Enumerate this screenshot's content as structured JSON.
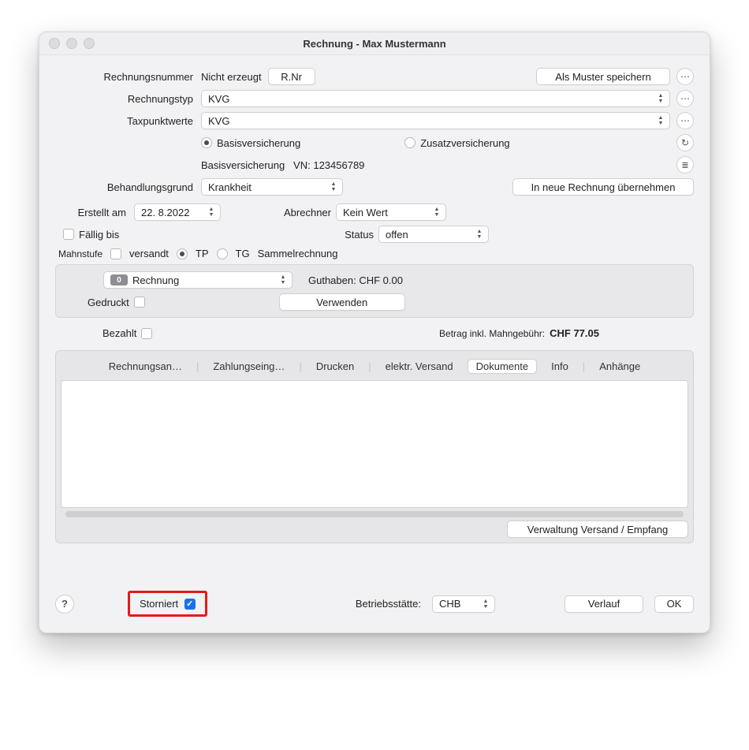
{
  "window": {
    "title": "Rechnung - Max Mustermann"
  },
  "labels": {
    "rechnungsnummer": "Rechnungsnummer",
    "rechnungstyp": "Rechnungstyp",
    "taxpunktwerte": "Taxpunktwerte",
    "behandlungsgrund": "Behandlungsgrund",
    "erstellt_am": "Erstellt am",
    "abrechner": "Abrechner",
    "faellig_bis": "Fällig bis",
    "status": "Status",
    "mahnstufe": "Mahnstufe",
    "versandt": "versandt",
    "tp": "TP",
    "tg": "TG",
    "sammelrechnung": "Sammelrechnung",
    "gedruckt": "Gedruckt",
    "bezahlt": "Bezahlt",
    "betriebsstaette": "Betriebsstätte:",
    "storniert": "Storniert"
  },
  "values": {
    "rechnungsnummer_text": "Nicht erzeugt",
    "rnr_btn": "R.Nr",
    "als_muster": "Als Muster speichern",
    "rechnungstyp_sel": "KVG",
    "taxpunktwerte_sel": "KVG",
    "versicherung_basis": "Basisversicherung",
    "versicherung_zusatz": "Zusatzversicherung",
    "versicherung_info": "Basisversicherung   VN: 123456789",
    "behandlungsgrund_sel": "Krankheit",
    "in_neue_rechnung": "In neue Rechnung übernehmen",
    "erstellt_am_val": "22.  8.2022",
    "abrechner_sel": "Kein Wert",
    "status_sel": "offen",
    "mahn_step_badge": "0",
    "mahn_step_text": "Rechnung",
    "guthaben": "Guthaben: CHF 0.00",
    "verwenden": "Verwenden",
    "betrag_label": "Betrag inkl. Mahngebühr:",
    "betrag_val": "CHF 77.05",
    "verwaltung": "Verwaltung Versand / Empfang",
    "betriebsstaette_sel": "CHB",
    "verlauf": "Verlauf",
    "ok": "OK"
  },
  "tabs": {
    "t1": "Rechnungsan…",
    "t2": "Zahlungseing…",
    "t3": "Drucken",
    "t4": "elektr. Versand",
    "t5": "Dokumente",
    "t6": "Info",
    "t7": "Anhänge"
  }
}
